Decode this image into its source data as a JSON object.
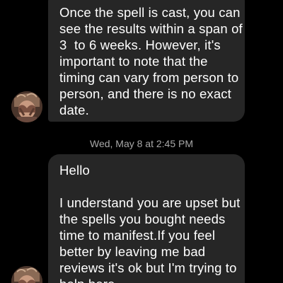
{
  "colors": {
    "background": "#000000",
    "bubble_incoming": "#262626",
    "message_text": "#ffffff",
    "timestamp_text": "#a8a8a8"
  },
  "thread": {
    "messages": [
      {
        "sender": "other",
        "avatar_icon": "profile-photo-icon",
        "lines": [
          "Once the spell is cast, you can",
          "see the results within a span of",
          "3  to 6 weeks. However, it's",
          "important to note that the",
          "timing can vary from person to",
          "person, and there is no exact",
          "date."
        ]
      },
      {
        "sender": "other",
        "avatar_icon": "profile-photo-icon",
        "lines": [
          "Hello",
          "",
          "I understand you are upset but",
          "the spells you bought needs",
          "time to manifest.If you feel",
          "better by leaving me bad",
          "reviews it's ok but I'm trying to",
          "help here."
        ]
      }
    ],
    "timestamp": "Wed, May 8 at 2:45 PM"
  }
}
